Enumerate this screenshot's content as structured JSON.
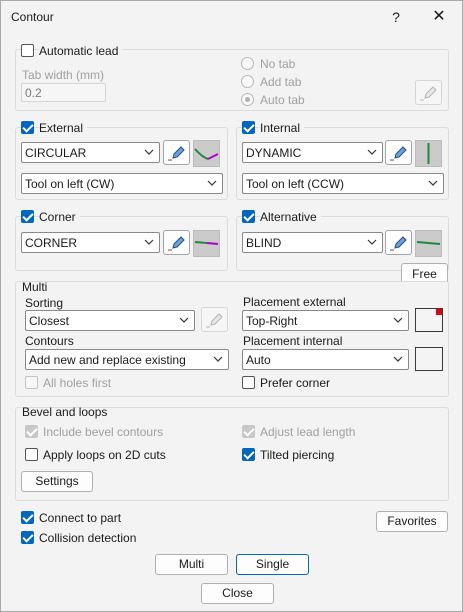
{
  "window": {
    "title": "Contour",
    "help_label": "?",
    "close_glyph": "✕"
  },
  "lead": {
    "automatic_lead_label": "Automatic lead",
    "automatic_lead_checked": false,
    "tab_width_label": "Tab width (mm)",
    "tab_width_value": "0.2",
    "tab_options": [
      "No tab",
      "Add tab",
      "Auto tab"
    ],
    "tab_selected": "Auto tab"
  },
  "external": {
    "label": "External",
    "checked": true,
    "lead_type": "CIRCULAR",
    "direction": "Tool on left (CW)"
  },
  "internal": {
    "label": "Internal",
    "checked": true,
    "lead_type": "DYNAMIC",
    "direction": "Tool on left (CCW)"
  },
  "corner": {
    "label": "Corner",
    "checked": true,
    "lead_type": "CORNER"
  },
  "alternative": {
    "label": "Alternative",
    "checked": true,
    "lead_type": "BLIND"
  },
  "free_label": "Free",
  "multi": {
    "title": "Multi",
    "sorting_label": "Sorting",
    "sorting_value": "Closest",
    "contours_label": "Contours",
    "contours_value": "Add new and replace existing",
    "all_holes_first_label": "All holes first",
    "all_holes_first_checked": false,
    "placement_external_label": "Placement external",
    "placement_external_value": "Top-Right",
    "placement_internal_label": "Placement internal",
    "placement_internal_value": "Auto",
    "prefer_corner_label": "Prefer corner",
    "prefer_corner_checked": false
  },
  "bevel": {
    "title": "Bevel and loops",
    "include_bevel_label": "Include bevel contours",
    "include_bevel_checked": true,
    "adjust_lead_label": "Adjust lead length",
    "adjust_lead_checked": true,
    "apply_loops_label": "Apply loops on 2D cuts",
    "apply_loops_checked": false,
    "tilted_piercing_label": "Tilted piercing",
    "tilted_piercing_checked": true,
    "settings_label": "Settings"
  },
  "footer": {
    "connect_to_part_label": "Connect to part",
    "connect_to_part_checked": true,
    "collision_detection_label": "Collision detection",
    "collision_detection_checked": true,
    "favorites_label": "Favorites",
    "multi_label": "Multi",
    "single_label": "Single",
    "close_label": "Close"
  },
  "colors": {
    "accent": "#0067c0",
    "preview_bg": "#cbcbcb",
    "lead_green": "#1f8a3a",
    "lead_purple": "#b000c8",
    "placement_red": "#e0001a"
  },
  "icons": {
    "edit": "pencil-icon",
    "chevron": "chevron-down-icon"
  }
}
